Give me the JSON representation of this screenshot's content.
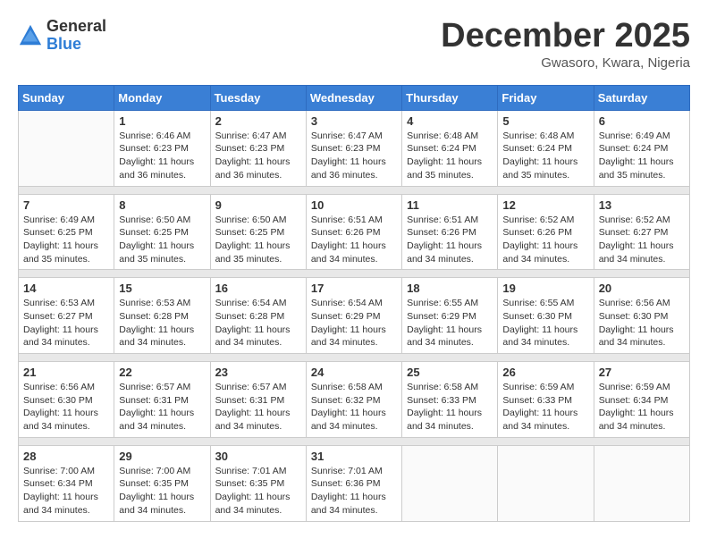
{
  "logo": {
    "general": "General",
    "blue": "Blue"
  },
  "title": "December 2025",
  "subtitle": "Gwasoro, Kwara, Nigeria",
  "days_of_week": [
    "Sunday",
    "Monday",
    "Tuesday",
    "Wednesday",
    "Thursday",
    "Friday",
    "Saturday"
  ],
  "weeks": [
    [
      {
        "day": "",
        "info": ""
      },
      {
        "day": "1",
        "info": "Sunrise: 6:46 AM\nSunset: 6:23 PM\nDaylight: 11 hours and 36 minutes."
      },
      {
        "day": "2",
        "info": "Sunrise: 6:47 AM\nSunset: 6:23 PM\nDaylight: 11 hours and 36 minutes."
      },
      {
        "day": "3",
        "info": "Sunrise: 6:47 AM\nSunset: 6:23 PM\nDaylight: 11 hours and 36 minutes."
      },
      {
        "day": "4",
        "info": "Sunrise: 6:48 AM\nSunset: 6:24 PM\nDaylight: 11 hours and 35 minutes."
      },
      {
        "day": "5",
        "info": "Sunrise: 6:48 AM\nSunset: 6:24 PM\nDaylight: 11 hours and 35 minutes."
      },
      {
        "day": "6",
        "info": "Sunrise: 6:49 AM\nSunset: 6:24 PM\nDaylight: 11 hours and 35 minutes."
      }
    ],
    [
      {
        "day": "7",
        "info": "Sunrise: 6:49 AM\nSunset: 6:25 PM\nDaylight: 11 hours and 35 minutes."
      },
      {
        "day": "8",
        "info": "Sunrise: 6:50 AM\nSunset: 6:25 PM\nDaylight: 11 hours and 35 minutes."
      },
      {
        "day": "9",
        "info": "Sunrise: 6:50 AM\nSunset: 6:25 PM\nDaylight: 11 hours and 35 minutes."
      },
      {
        "day": "10",
        "info": "Sunrise: 6:51 AM\nSunset: 6:26 PM\nDaylight: 11 hours and 34 minutes."
      },
      {
        "day": "11",
        "info": "Sunrise: 6:51 AM\nSunset: 6:26 PM\nDaylight: 11 hours and 34 minutes."
      },
      {
        "day": "12",
        "info": "Sunrise: 6:52 AM\nSunset: 6:26 PM\nDaylight: 11 hours and 34 minutes."
      },
      {
        "day": "13",
        "info": "Sunrise: 6:52 AM\nSunset: 6:27 PM\nDaylight: 11 hours and 34 minutes."
      }
    ],
    [
      {
        "day": "14",
        "info": "Sunrise: 6:53 AM\nSunset: 6:27 PM\nDaylight: 11 hours and 34 minutes."
      },
      {
        "day": "15",
        "info": "Sunrise: 6:53 AM\nSunset: 6:28 PM\nDaylight: 11 hours and 34 minutes."
      },
      {
        "day": "16",
        "info": "Sunrise: 6:54 AM\nSunset: 6:28 PM\nDaylight: 11 hours and 34 minutes."
      },
      {
        "day": "17",
        "info": "Sunrise: 6:54 AM\nSunset: 6:29 PM\nDaylight: 11 hours and 34 minutes."
      },
      {
        "day": "18",
        "info": "Sunrise: 6:55 AM\nSunset: 6:29 PM\nDaylight: 11 hours and 34 minutes."
      },
      {
        "day": "19",
        "info": "Sunrise: 6:55 AM\nSunset: 6:30 PM\nDaylight: 11 hours and 34 minutes."
      },
      {
        "day": "20",
        "info": "Sunrise: 6:56 AM\nSunset: 6:30 PM\nDaylight: 11 hours and 34 minutes."
      }
    ],
    [
      {
        "day": "21",
        "info": "Sunrise: 6:56 AM\nSunset: 6:30 PM\nDaylight: 11 hours and 34 minutes."
      },
      {
        "day": "22",
        "info": "Sunrise: 6:57 AM\nSunset: 6:31 PM\nDaylight: 11 hours and 34 minutes."
      },
      {
        "day": "23",
        "info": "Sunrise: 6:57 AM\nSunset: 6:31 PM\nDaylight: 11 hours and 34 minutes."
      },
      {
        "day": "24",
        "info": "Sunrise: 6:58 AM\nSunset: 6:32 PM\nDaylight: 11 hours and 34 minutes."
      },
      {
        "day": "25",
        "info": "Sunrise: 6:58 AM\nSunset: 6:33 PM\nDaylight: 11 hours and 34 minutes."
      },
      {
        "day": "26",
        "info": "Sunrise: 6:59 AM\nSunset: 6:33 PM\nDaylight: 11 hours and 34 minutes."
      },
      {
        "day": "27",
        "info": "Sunrise: 6:59 AM\nSunset: 6:34 PM\nDaylight: 11 hours and 34 minutes."
      }
    ],
    [
      {
        "day": "28",
        "info": "Sunrise: 7:00 AM\nSunset: 6:34 PM\nDaylight: 11 hours and 34 minutes."
      },
      {
        "day": "29",
        "info": "Sunrise: 7:00 AM\nSunset: 6:35 PM\nDaylight: 11 hours and 34 minutes."
      },
      {
        "day": "30",
        "info": "Sunrise: 7:01 AM\nSunset: 6:35 PM\nDaylight: 11 hours and 34 minutes."
      },
      {
        "day": "31",
        "info": "Sunrise: 7:01 AM\nSunset: 6:36 PM\nDaylight: 11 hours and 34 minutes."
      },
      {
        "day": "",
        "info": ""
      },
      {
        "day": "",
        "info": ""
      },
      {
        "day": "",
        "info": ""
      }
    ]
  ]
}
